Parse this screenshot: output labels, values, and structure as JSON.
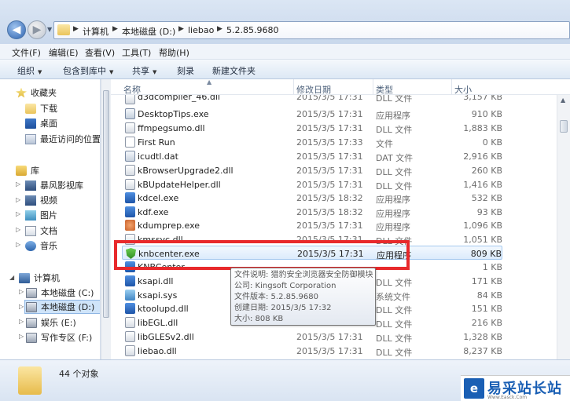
{
  "address": {
    "breadcrumbs": [
      "计算机",
      "本地磁盘 (D:)",
      "liebao",
      "5.2.85.9680"
    ]
  },
  "menu": [
    "文件(F)",
    "编辑(E)",
    "查看(V)",
    "工具(T)",
    "帮助(H)"
  ],
  "commands": {
    "organize": "组织",
    "include_library": "包含到库中",
    "share": "共享",
    "burn": "刻录",
    "new_folder": "新建文件夹"
  },
  "nav": {
    "favorites": "收藏夹",
    "downloads": "下载",
    "desktop": "桌面",
    "recent": "最近访问的位置",
    "libraries": "库",
    "storm_video": "暴风影视库",
    "videos": "视频",
    "pictures": "图片",
    "documents": "文档",
    "music": "音乐",
    "computer": "计算机",
    "drive_c": "本地磁盘 (C:)",
    "drive_d": "本地磁盘 (D:)",
    "drive_e": "娱乐 (E:)",
    "drive_f": "写作专区 (F:)"
  },
  "columns": {
    "name": "名称",
    "modified": "修改日期",
    "type": "类型",
    "size": "大小"
  },
  "files": [
    {
      "name": "d3dcompiler_46.dll",
      "date": "2015/3/5 17:31",
      "type": "DLL 文件",
      "size": "3,157 KB",
      "icon": "dll-file-icon"
    },
    {
      "name": "DesktopTips.exe",
      "date": "2015/3/5 17:31",
      "type": "应用程序",
      "size": "910 KB",
      "icon": "exe-file-icon"
    },
    {
      "name": "ffmpegsumo.dll",
      "date": "2015/3/5 17:31",
      "type": "DLL 文件",
      "size": "1,883 KB",
      "icon": "dll-file-icon"
    },
    {
      "name": "First Run",
      "date": "2015/3/5 17:33",
      "type": "文件",
      "size": "0 KB",
      "icon": "blank-file-icon"
    },
    {
      "name": "icudtl.dat",
      "date": "2015/3/5 17:31",
      "type": "DAT 文件",
      "size": "2,916 KB",
      "icon": "dat-file-icon"
    },
    {
      "name": "kBrowserUpgrade2.dll",
      "date": "2015/3/5 17:31",
      "type": "DLL 文件",
      "size": "260 KB",
      "icon": "dll-file-icon"
    },
    {
      "name": "kBUpdateHelper.dll",
      "date": "2015/3/5 17:31",
      "type": "DLL 文件",
      "size": "1,416 KB",
      "icon": "dll-file-icon"
    },
    {
      "name": "kdcel.exe",
      "date": "2015/3/5 18:32",
      "type": "应用程序",
      "size": "532 KB",
      "icon": "k-app-icon"
    },
    {
      "name": "kdf.exe",
      "date": "2015/3/5 18:32",
      "type": "应用程序",
      "size": "93 KB",
      "icon": "k-app-icon"
    },
    {
      "name": "kdumprep.exe",
      "date": "2015/3/5 17:31",
      "type": "应用程序",
      "size": "1,096 KB",
      "icon": "dump-app-icon"
    },
    {
      "name": "kmssvc.dll",
      "date": "2015/3/5 17:31",
      "type": "DLL 文件",
      "size": "1,051 KB",
      "icon": "dll-file-icon"
    },
    {
      "name": "knbcenter.exe",
      "date": "2015/3/5 17:31",
      "type": "应用程序",
      "size": "809 KB",
      "icon": "shield-app-icon"
    },
    {
      "name": "KNBCenter...",
      "date": "",
      "type": "",
      "size": "1 KB",
      "icon": "k-app-icon"
    },
    {
      "name": "ksapi.dll",
      "date": "",
      "type": "DLL 文件",
      "size": "171 KB",
      "icon": "k-app-icon"
    },
    {
      "name": "ksapi.sys",
      "date": "",
      "type": "系统文件",
      "size": "84 KB",
      "icon": "sys-file-icon"
    },
    {
      "name": "ktoolupd.dll",
      "date": "",
      "type": "DLL 文件",
      "size": "151 KB",
      "icon": "k-app-icon"
    },
    {
      "name": "libEGL.dll",
      "date": "",
      "type": "DLL 文件",
      "size": "216 KB",
      "icon": "dll-file-icon"
    },
    {
      "name": "libGLESv2.dll",
      "date": "2015/3/5 17:31",
      "type": "DLL 文件",
      "size": "1,328 KB",
      "icon": "dll-file-icon"
    },
    {
      "name": "liebao.dll",
      "date": "2015/3/5 17:31",
      "type": "DLL 文件",
      "size": "8,237 KB",
      "icon": "dll-file-icon"
    }
  ],
  "tooltip": {
    "desc": "文件说明: 猎豹安全浏览器安全防御模块",
    "company": "公司: Kingsoft Corporation",
    "version": "文件版本: 5.2.85.9680",
    "created": "创建日期: 2015/3/5 17:32",
    "size": "大小: 808 KB"
  },
  "status": {
    "count": "44 个对象"
  },
  "watermark": {
    "text": "易采站长站",
    "url": "Www.Easck.Com"
  },
  "colors": {
    "highlight": "#e8292b",
    "selection": "#dcebfc",
    "accent": "#1a5fb4"
  }
}
